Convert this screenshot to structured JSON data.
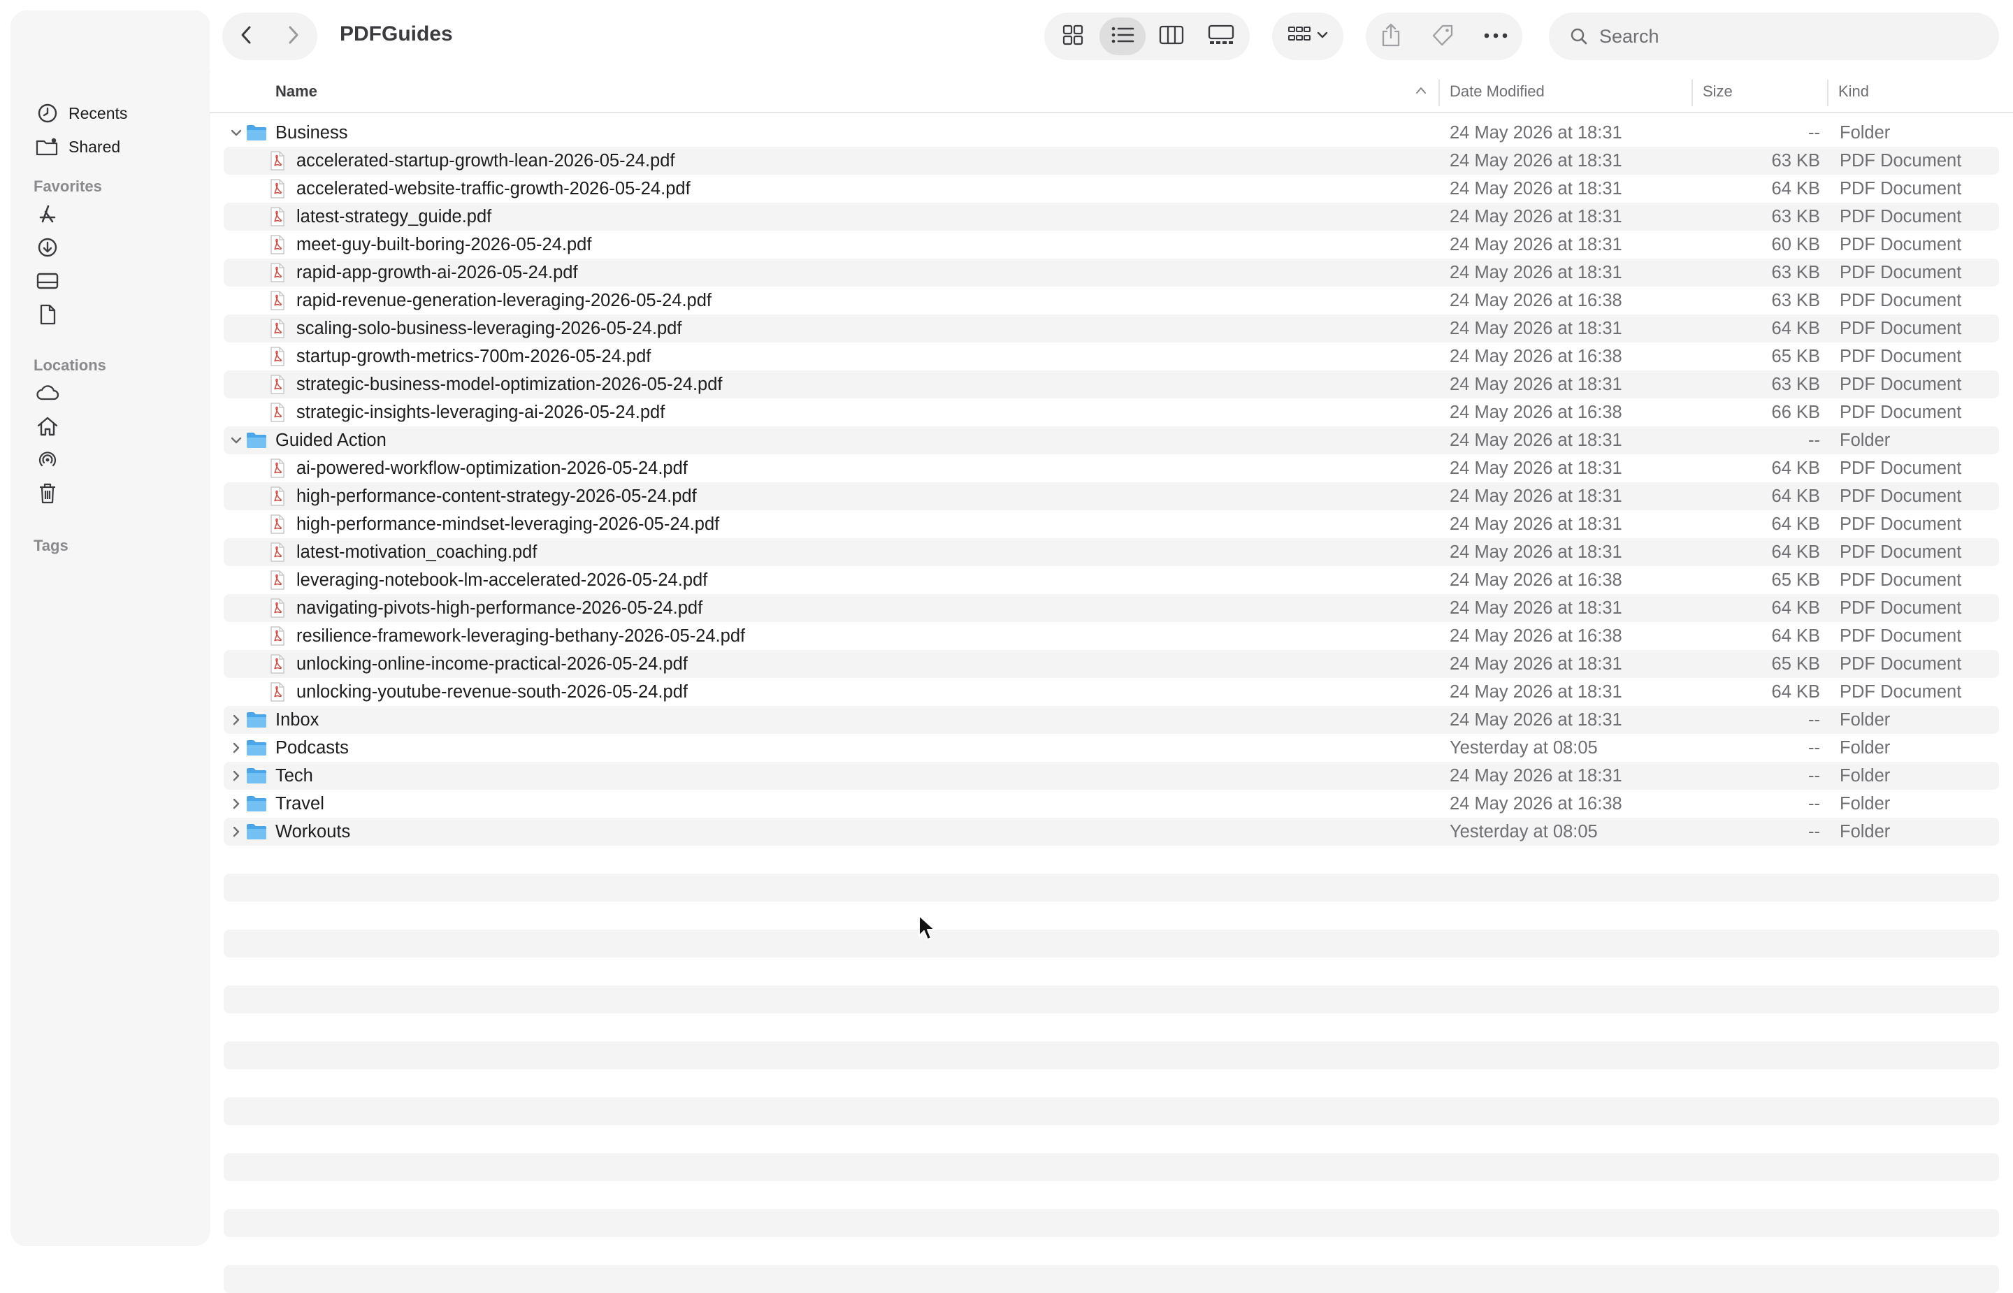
{
  "window": {
    "title": "PDFGuides"
  },
  "sidebar": {
    "recents": {
      "label": "Recents",
      "icon": "clock-icon"
    },
    "shared": {
      "label": "Shared",
      "icon": "shared-folder-icon"
    },
    "favorites_heading": "Favorites",
    "favorites_icons": [
      "applications-icon",
      "downloads-icon",
      "drive-icon",
      "document-icon"
    ],
    "locations_heading": "Locations",
    "locations_icons": [
      "icloud-icon",
      "home-icon",
      "airdrop-icon",
      "trash-icon"
    ],
    "tags_heading": "Tags"
  },
  "toolbar": {
    "back_icon": "chevron-left-icon",
    "forward_icon": "chevron-right-icon",
    "views": [
      "icon-view",
      "list-view",
      "column-view",
      "gallery-view"
    ],
    "active_view": "list-view",
    "search_placeholder": "Search"
  },
  "columns": {
    "name": "Name",
    "date": "Date Modified",
    "size": "Size",
    "kind": "Kind"
  },
  "rows": [
    {
      "type": "folder",
      "expanded": true,
      "name": "Business",
      "date": "24 May 2026 at 18:31",
      "size": "--",
      "kind": "Folder"
    },
    {
      "type": "pdf",
      "name": "accelerated-startup-growth-lean-2026-05-24.pdf",
      "date": "24 May 2026 at 18:31",
      "size": "63 KB",
      "kind": "PDF Document"
    },
    {
      "type": "pdf",
      "name": "accelerated-website-traffic-growth-2026-05-24.pdf",
      "date": "24 May 2026 at 18:31",
      "size": "64 KB",
      "kind": "PDF Document"
    },
    {
      "type": "pdf",
      "name": "latest-strategy_guide.pdf",
      "date": "24 May 2026 at 18:31",
      "size": "63 KB",
      "kind": "PDF Document"
    },
    {
      "type": "pdf",
      "name": "meet-guy-built-boring-2026-05-24.pdf",
      "date": "24 May 2026 at 18:31",
      "size": "60 KB",
      "kind": "PDF Document"
    },
    {
      "type": "pdf",
      "name": "rapid-app-growth-ai-2026-05-24.pdf",
      "date": "24 May 2026 at 18:31",
      "size": "63 KB",
      "kind": "PDF Document"
    },
    {
      "type": "pdf",
      "name": "rapid-revenue-generation-leveraging-2026-05-24.pdf",
      "date": "24 May 2026 at 16:38",
      "size": "63 KB",
      "kind": "PDF Document"
    },
    {
      "type": "pdf",
      "name": "scaling-solo-business-leveraging-2026-05-24.pdf",
      "date": "24 May 2026 at 18:31",
      "size": "64 KB",
      "kind": "PDF Document"
    },
    {
      "type": "pdf",
      "name": "startup-growth-metrics-700m-2026-05-24.pdf",
      "date": "24 May 2026 at 16:38",
      "size": "65 KB",
      "kind": "PDF Document"
    },
    {
      "type": "pdf",
      "name": "strategic-business-model-optimization-2026-05-24.pdf",
      "date": "24 May 2026 at 18:31",
      "size": "63 KB",
      "kind": "PDF Document"
    },
    {
      "type": "pdf",
      "name": "strategic-insights-leveraging-ai-2026-05-24.pdf",
      "date": "24 May 2026 at 16:38",
      "size": "66 KB",
      "kind": "PDF Document"
    },
    {
      "type": "folder",
      "expanded": true,
      "name": "Guided Action",
      "date": "24 May 2026 at 18:31",
      "size": "--",
      "kind": "Folder"
    },
    {
      "type": "pdf",
      "name": "ai-powered-workflow-optimization-2026-05-24.pdf",
      "date": "24 May 2026 at 18:31",
      "size": "64 KB",
      "kind": "PDF Document"
    },
    {
      "type": "pdf",
      "name": "high-performance-content-strategy-2026-05-24.pdf",
      "date": "24 May 2026 at 18:31",
      "size": "64 KB",
      "kind": "PDF Document"
    },
    {
      "type": "pdf",
      "name": "high-performance-mindset-leveraging-2026-05-24.pdf",
      "date": "24 May 2026 at 18:31",
      "size": "64 KB",
      "kind": "PDF Document"
    },
    {
      "type": "pdf",
      "name": "latest-motivation_coaching.pdf",
      "date": "24 May 2026 at 18:31",
      "size": "64 KB",
      "kind": "PDF Document"
    },
    {
      "type": "pdf",
      "name": "leveraging-notebook-lm-accelerated-2026-05-24.pdf",
      "date": "24 May 2026 at 16:38",
      "size": "65 KB",
      "kind": "PDF Document"
    },
    {
      "type": "pdf",
      "name": "navigating-pivots-high-performance-2026-05-24.pdf",
      "date": "24 May 2026 at 18:31",
      "size": "64 KB",
      "kind": "PDF Document"
    },
    {
      "type": "pdf",
      "name": "resilience-framework-leveraging-bethany-2026-05-24.pdf",
      "date": "24 May 2026 at 16:38",
      "size": "64 KB",
      "kind": "PDF Document"
    },
    {
      "type": "pdf",
      "name": "unlocking-online-income-practical-2026-05-24.pdf",
      "date": "24 May 2026 at 18:31",
      "size": "65 KB",
      "kind": "PDF Document"
    },
    {
      "type": "pdf",
      "name": "unlocking-youtube-revenue-south-2026-05-24.pdf",
      "date": "24 May 2026 at 18:31",
      "size": "64 KB",
      "kind": "PDF Document"
    },
    {
      "type": "folder",
      "expanded": false,
      "name": "Inbox",
      "date": "24 May 2026 at 18:31",
      "size": "--",
      "kind": "Folder"
    },
    {
      "type": "folder",
      "expanded": false,
      "name": "Podcasts",
      "date": "Yesterday at 08:05",
      "size": "--",
      "kind": "Folder"
    },
    {
      "type": "folder",
      "expanded": false,
      "name": "Tech",
      "date": "24 May 2026 at 18:31",
      "size": "--",
      "kind": "Folder"
    },
    {
      "type": "folder",
      "expanded": false,
      "name": "Travel",
      "date": "24 May 2026 at 16:38",
      "size": "--",
      "kind": "Folder"
    },
    {
      "type": "folder",
      "expanded": false,
      "name": "Workouts",
      "date": "Yesterday at 08:05",
      "size": "--",
      "kind": "Folder"
    }
  ],
  "colors": {
    "folder": "#4aa6e8",
    "pdf": "#d0473e",
    "stripe": "#f4f4f5"
  }
}
